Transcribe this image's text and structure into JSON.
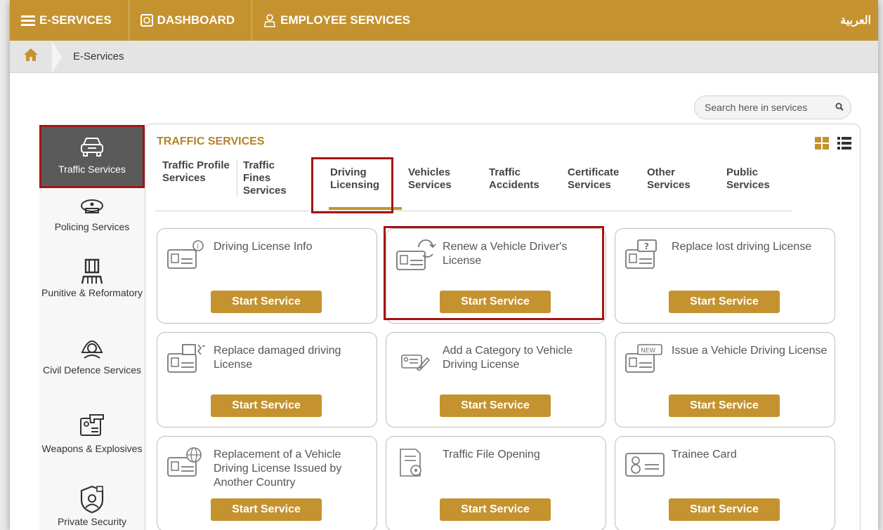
{
  "topbar": {
    "eservices": "E-SERVICES",
    "dashboard": "DASHBOARD",
    "employee": "EMPLOYEE SERVICES",
    "language": "العربية"
  },
  "breadcrumb": {
    "current": "E-Services"
  },
  "search": {
    "placeholder": "Search here in services"
  },
  "sidebar": {
    "items": [
      {
        "label": "Traffic Services",
        "icon": "car-icon"
      },
      {
        "label": "Policing Services",
        "icon": "police-cap-icon"
      },
      {
        "label": "Punitive & Reformatory",
        "icon": "prison-icon"
      },
      {
        "label": "Civil Defence Services",
        "icon": "fireman-icon"
      },
      {
        "label": "Weapons & Explosives",
        "icon": "weapon-license-icon"
      },
      {
        "label": "Private Security",
        "icon": "security-guard-icon"
      }
    ]
  },
  "panel": {
    "title": "TRAFFIC SERVICES",
    "tabs": [
      {
        "label": "Traffic Profile Services"
      },
      {
        "label": "Traffic Fines Services"
      },
      {
        "label": "Driving Licensing"
      },
      {
        "label": "Vehicles Services"
      },
      {
        "label": "Traffic Accidents"
      },
      {
        "label": "Certificate Services"
      },
      {
        "label": "Other Services"
      },
      {
        "label": "Public Services"
      }
    ]
  },
  "cards": [
    {
      "title": "Driving License Info",
      "button": "Start Service",
      "icon": "license-info-icon"
    },
    {
      "title": "Renew a Vehicle Driver's License",
      "button": "Start Service",
      "icon": "license-renew-icon"
    },
    {
      "title": "Replace lost driving License",
      "button": "Start Service",
      "icon": "license-lost-icon"
    },
    {
      "title": "Replace damaged driving License",
      "button": "Start Service",
      "icon": "license-damaged-icon"
    },
    {
      "title": "Add a Category to Vehicle Driving License",
      "button": "Start Service",
      "icon": "license-add-icon"
    },
    {
      "title": "Issue a Vehicle Driving License",
      "button": "Start Service",
      "icon": "license-new-icon"
    },
    {
      "title": "Replacement of a Vehicle Driving License Issued by Another Country",
      "button": "Start Service",
      "icon": "license-globe-icon"
    },
    {
      "title": "Traffic File Opening",
      "button": "Start Service",
      "icon": "traffic-file-icon"
    },
    {
      "title": "Trainee Card",
      "button": "Start Service",
      "icon": "trainee-card-icon"
    }
  ],
  "colors": {
    "accent": "#c4922f",
    "highlight": "#a31515",
    "sidebar_active": "#5a5a5a"
  }
}
